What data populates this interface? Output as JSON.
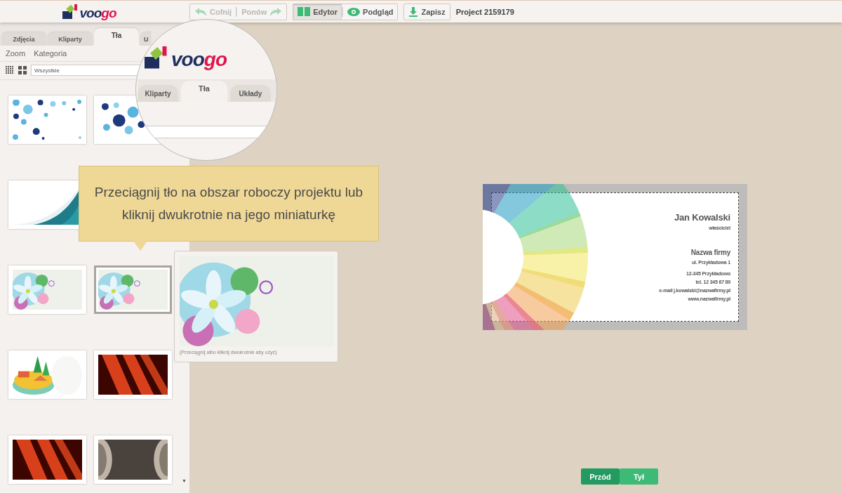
{
  "header": {
    "logo": [
      "voo",
      "go"
    ],
    "history": [
      {
        "label": "Cofnij",
        "disabled": true
      },
      {
        "label": "Ponów",
        "disabled": true
      }
    ],
    "modes": [
      {
        "label": "Edytor",
        "selected": true
      },
      {
        "label": "Podgląd",
        "selected": false
      }
    ],
    "save": "Zapisz",
    "project": "Project 2159179"
  },
  "sidebar": {
    "tabs": [
      {
        "label": "Zdjęcia",
        "selected": false
      },
      {
        "label": "Kliparty",
        "selected": false
      },
      {
        "label": "Tła",
        "selected": true
      },
      {
        "label": "U",
        "selected": false
      }
    ],
    "menu": [
      "Zoom",
      "Kategoria"
    ],
    "category": "Wszystkie",
    "thumbnail_rows": [
      [
        {
          "selected": false
        },
        {
          "selected": false
        }
      ],
      [
        {
          "selected": false
        }
      ],
      [
        {
          "selected": false
        },
        {
          "selected": true
        }
      ],
      [
        {
          "selected": false
        },
        {
          "selected": false
        }
      ],
      [
        {
          "selected": false
        },
        {
          "selected": false
        }
      ]
    ],
    "scroll_down": "▼"
  },
  "magnifier": {
    "logo": [
      "voo",
      "go"
    ],
    "tabs": [
      {
        "label": "Kliparty",
        "selected": false
      },
      {
        "label": "Tła",
        "selected": true
      },
      {
        "label": "Układy",
        "selected": false
      }
    ]
  },
  "tooltip": "Przeciągnij tło na obszar roboczy projektu lub kliknij dwukrotnie na jego miniaturkę",
  "preview": {
    "caption": "(Przeciągnij albo kliknij dwukrotnie aby użyć)"
  },
  "card": {
    "name": "Jan Kowalski",
    "role": "właściciel",
    "company": "Nazwa firmy",
    "address": [
      "ul. Przykładowa 1"
    ],
    "contact": [
      "12-345 Przykładowo",
      "tel. 12 345 67 89",
      "e-mail j.kowalski@nazwafirmy.pl",
      "www.nazwafirmy.pl"
    ]
  },
  "sides": [
    {
      "label": "Przód",
      "selected": true
    },
    {
      "label": "Tył",
      "selected": false
    }
  ]
}
